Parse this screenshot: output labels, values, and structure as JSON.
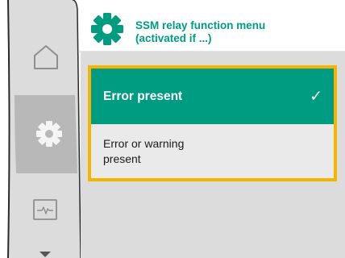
{
  "header": {
    "title_line1": "SSM relay function menu",
    "title_line2": "(activated if ...)"
  },
  "nav": {
    "items": [
      {
        "icon": "home-icon",
        "active": false
      },
      {
        "icon": "gear-icon",
        "active": true
      },
      {
        "icon": "diagnostics-icon",
        "active": false
      }
    ],
    "more_indicator": "chevron-down-icon"
  },
  "options": [
    {
      "label": "Error present",
      "selected": true
    },
    {
      "label_line1": "Error or warning",
      "label_line2": "present",
      "selected": false
    }
  ],
  "colors": {
    "accent": "#009c82",
    "focus": "#f4b400",
    "panel": "#dcdcdc",
    "option_bg": "#eaeaea",
    "rail": "#8f8f8f"
  }
}
